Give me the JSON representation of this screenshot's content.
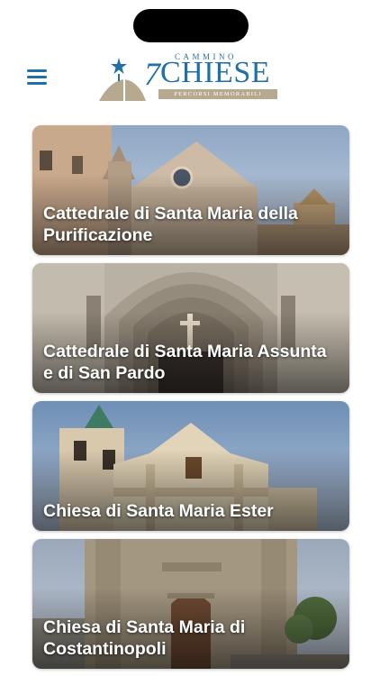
{
  "logo": {
    "top_word": "CAMMINO",
    "number": "7",
    "word": "CHIESE",
    "subtitle": "PERCORSI MEMORABILI"
  },
  "header": {
    "menu_icon": "hamburger-menu-icon"
  },
  "churches": [
    {
      "title": "Cattedrale di Santa Maria della Purificazione"
    },
    {
      "title": "Cattedrale di Santa Maria Assunta e di San Pardo"
    },
    {
      "title": "Chiesa di Santa Maria Ester"
    },
    {
      "title": "Chiesa di Santa Maria di Costantinopoli"
    }
  ],
  "colors": {
    "brand_blue": "#1f6fa8",
    "brand_tan": "#b7a98f"
  }
}
